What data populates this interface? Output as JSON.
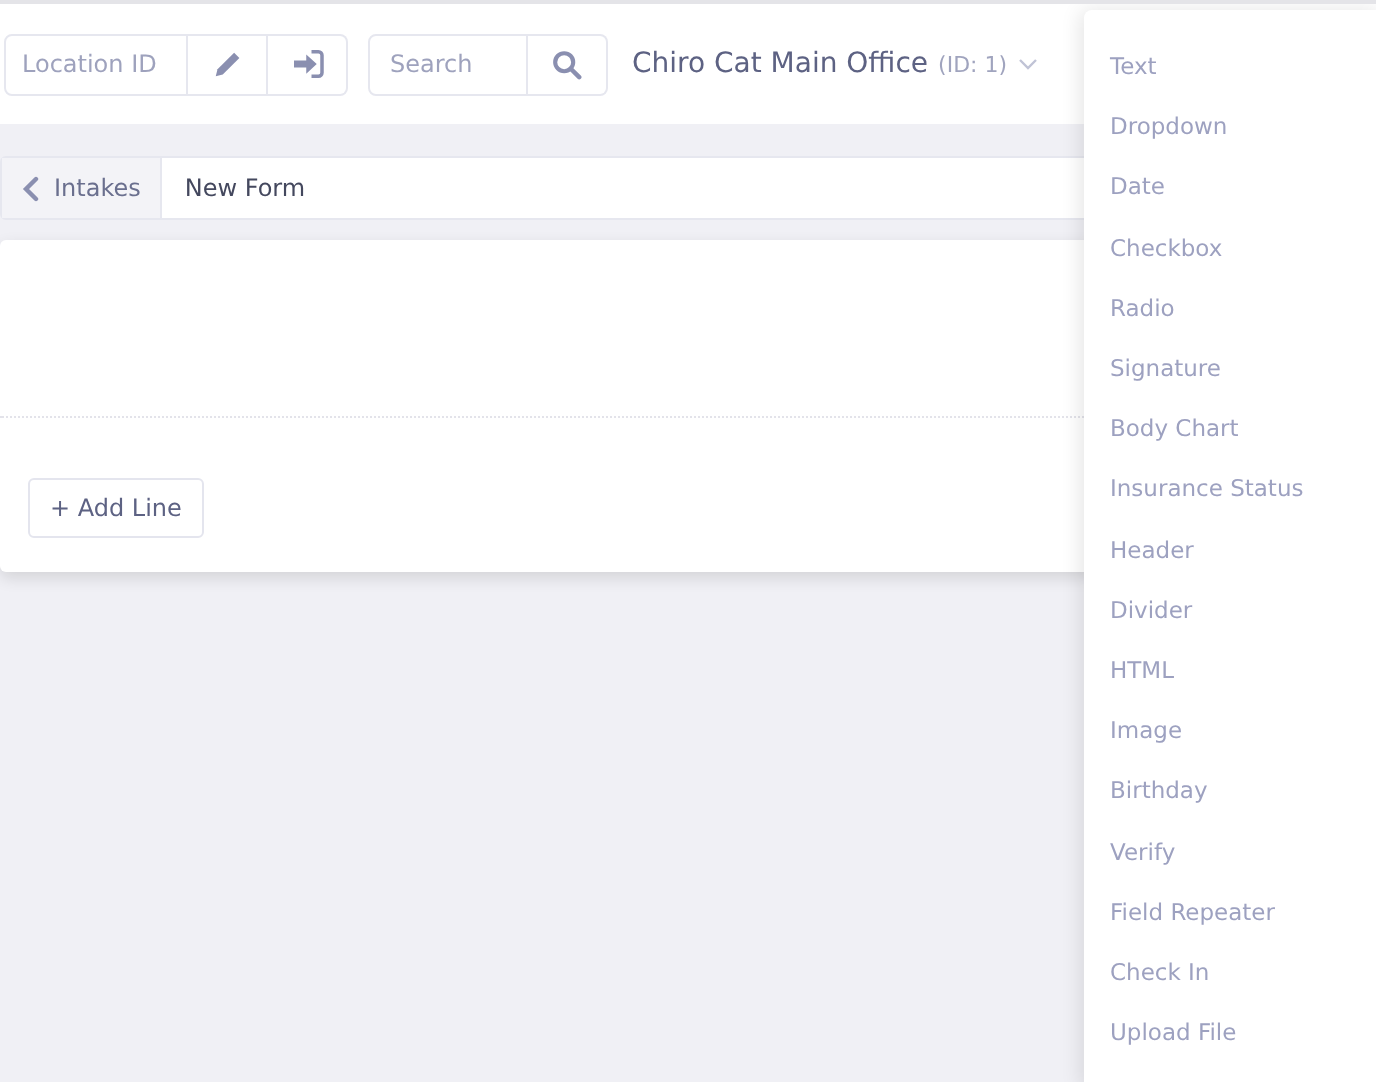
{
  "topbar": {
    "location_field": {
      "placeholder": "Location ID"
    },
    "search_field": {
      "placeholder": "Search"
    },
    "office": {
      "name": "Chiro Cat Main Office",
      "id_label": "(ID: 1)"
    }
  },
  "breadcrumb": {
    "back": "Intakes",
    "current": "New Form"
  },
  "form": {
    "add_line": "+ Add Line"
  },
  "menu": [
    "Text",
    "Dropdown",
    "Date",
    "Checkbox",
    "Radio",
    "Signature",
    "Body Chart",
    "Insurance Status",
    "Header",
    "Divider",
    "HTML",
    "Image",
    "Birthday",
    "Verify",
    "Field Repeater",
    "Check In",
    "Upload File"
  ]
}
